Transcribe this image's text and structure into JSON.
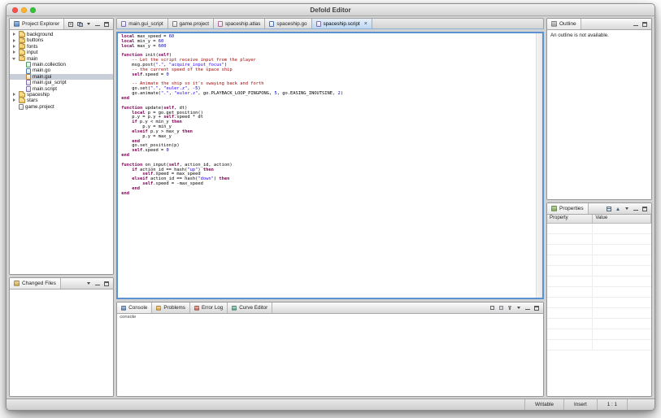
{
  "window": {
    "title": "Defold Editor"
  },
  "explorer": {
    "title": "Project Explorer",
    "items": [
      {
        "label": "background",
        "type": "folder",
        "expand": "collapsed",
        "depth": 0
      },
      {
        "label": "buttons",
        "type": "folder",
        "expand": "collapsed",
        "depth": 0
      },
      {
        "label": "fonts",
        "type": "folder",
        "expand": "collapsed",
        "depth": 0
      },
      {
        "label": "input",
        "type": "folder",
        "expand": "collapsed",
        "depth": 0
      },
      {
        "label": "main",
        "type": "folder",
        "expand": "expanded",
        "depth": 0
      },
      {
        "label": "main.collection",
        "type": "collection",
        "expand": "none",
        "depth": 1
      },
      {
        "label": "main.go",
        "type": "go",
        "expand": "none",
        "depth": 1
      },
      {
        "label": "main.gui",
        "type": "gui",
        "expand": "none",
        "depth": 1,
        "selected": true
      },
      {
        "label": "main.gui_script",
        "type": "script",
        "expand": "none",
        "depth": 1
      },
      {
        "label": "main.script",
        "type": "script",
        "expand": "none",
        "depth": 1
      },
      {
        "label": "spaceship",
        "type": "folder",
        "expand": "collapsed",
        "depth": 0
      },
      {
        "label": "stars",
        "type": "folder",
        "expand": "collapsed",
        "depth": 0
      },
      {
        "label": "game.project",
        "type": "project",
        "expand": "none",
        "depth": 0
      }
    ]
  },
  "changed_files": {
    "title": "Changed Files"
  },
  "editor": {
    "close_glyph": "×",
    "tabs": [
      {
        "label": "main.gui_script",
        "type": "script",
        "active": false
      },
      {
        "label": "game.project",
        "type": "project",
        "active": false
      },
      {
        "label": "spaceship.atlas",
        "type": "atlas",
        "active": false
      },
      {
        "label": "spaceship.go",
        "type": "go",
        "active": false
      },
      {
        "label": "spaceship.script",
        "type": "script",
        "active": true
      }
    ],
    "code_lines": [
      [
        [
          "k",
          "local"
        ],
        [
          "p",
          " max_speed = "
        ],
        [
          "n",
          "60"
        ]
      ],
      [
        [
          "k",
          "local"
        ],
        [
          "p",
          " min_y = "
        ],
        [
          "n",
          "60"
        ]
      ],
      [
        [
          "k",
          "local"
        ],
        [
          "p",
          " max_y = "
        ],
        [
          "n",
          "600"
        ]
      ],
      [],
      [
        [
          "k",
          "function"
        ],
        [
          "p",
          " init("
        ],
        [
          "k",
          "self"
        ],
        [
          "p",
          ")"
        ]
      ],
      [
        [
          "c",
          "    -- Let the script receive input from the player"
        ]
      ],
      [
        [
          "p",
          "    msg.post("
        ],
        [
          "s",
          "\".\""
        ],
        [
          "p",
          ", "
        ],
        [
          "s",
          "\"acquire_input_focus\""
        ],
        [
          "p",
          ")"
        ]
      ],
      [
        [
          "c",
          "    -- the current speed of the space ship"
        ]
      ],
      [
        [
          "p",
          "    "
        ],
        [
          "k",
          "self"
        ],
        [
          "p",
          ".speed = "
        ],
        [
          "n",
          "0"
        ]
      ],
      [],
      [
        [
          "c",
          "    -- Animate the ship so it's swaying back and forth"
        ]
      ],
      [
        [
          "p",
          "    go.set("
        ],
        [
          "s",
          "\".\""
        ],
        [
          "p",
          ", "
        ],
        [
          "s",
          "\"euler.z\""
        ],
        [
          "p",
          ", "
        ],
        [
          "n",
          "-5"
        ],
        [
          "p",
          ")"
        ]
      ],
      [
        [
          "p",
          "    go.animate("
        ],
        [
          "s",
          "\".\""
        ],
        [
          "p",
          ", "
        ],
        [
          "s",
          "\"euler.z\""
        ],
        [
          "p",
          ", go.PLAYBACK_LOOP_PINGPONG, "
        ],
        [
          "n",
          "5"
        ],
        [
          "p",
          ", go.EASING_INOUTSINE, "
        ],
        [
          "n",
          "2"
        ],
        [
          "p",
          ")"
        ]
      ],
      [
        [
          "k",
          "end"
        ]
      ],
      [],
      [
        [
          "k",
          "function"
        ],
        [
          "p",
          " update("
        ],
        [
          "k",
          "self"
        ],
        [
          "p",
          ", dt)"
        ]
      ],
      [
        [
          "p",
          "    "
        ],
        [
          "k",
          "local"
        ],
        [
          "p",
          " p = go.get_position()"
        ]
      ],
      [
        [
          "p",
          "    p.y = p.y + "
        ],
        [
          "k",
          "self"
        ],
        [
          "p",
          ".speed * dt"
        ]
      ],
      [
        [
          "p",
          "    "
        ],
        [
          "k",
          "if"
        ],
        [
          "p",
          " p.y < min_y "
        ],
        [
          "k",
          "then"
        ]
      ],
      [
        [
          "p",
          "        p.y = min_y"
        ]
      ],
      [
        [
          "p",
          "    "
        ],
        [
          "k",
          "elseif"
        ],
        [
          "p",
          " p.y > max_y "
        ],
        [
          "k",
          "then"
        ]
      ],
      [
        [
          "p",
          "        p.y = max_y"
        ]
      ],
      [
        [
          "p",
          "    "
        ],
        [
          "k",
          "end"
        ]
      ],
      [
        [
          "p",
          "    go.set_position(p)"
        ]
      ],
      [
        [
          "p",
          "    "
        ],
        [
          "k",
          "self"
        ],
        [
          "p",
          ".speed = "
        ],
        [
          "n",
          "0"
        ]
      ],
      [
        [
          "k",
          "end"
        ]
      ],
      [],
      [
        [
          "k",
          "function"
        ],
        [
          "p",
          " on_input("
        ],
        [
          "k",
          "self"
        ],
        [
          "p",
          ", action_id, action)"
        ]
      ],
      [
        [
          "p",
          "    "
        ],
        [
          "k",
          "if"
        ],
        [
          "p",
          " action_id == hash("
        ],
        [
          "s",
          "\"up\""
        ],
        [
          "p",
          ") "
        ],
        [
          "k",
          "then"
        ]
      ],
      [
        [
          "p",
          "        "
        ],
        [
          "k",
          "self"
        ],
        [
          "p",
          ".speed = max_speed"
        ]
      ],
      [
        [
          "p",
          "    "
        ],
        [
          "k",
          "elseif"
        ],
        [
          "p",
          " action_id == hash("
        ],
        [
          "s",
          "\"down\""
        ],
        [
          "p",
          ") "
        ],
        [
          "k",
          "then"
        ]
      ],
      [
        [
          "p",
          "        "
        ],
        [
          "k",
          "self"
        ],
        [
          "p",
          ".speed = -max_speed"
        ]
      ],
      [
        [
          "p",
          "    "
        ],
        [
          "k",
          "end"
        ]
      ],
      [
        [
          "k",
          "end"
        ]
      ]
    ]
  },
  "outline": {
    "title": "Outline",
    "message": "An outline is not available."
  },
  "properties": {
    "title": "Properties",
    "columns": [
      "Property",
      "Value"
    ]
  },
  "console": {
    "label": "console",
    "tabs": [
      {
        "label": "Console",
        "active": true
      },
      {
        "label": "Problems",
        "active": false
      },
      {
        "label": "Error Log",
        "active": false
      },
      {
        "label": "Curve Editor",
        "active": false
      }
    ]
  },
  "statusbar": {
    "items": [
      "Writable",
      "Insert",
      "1 : 1"
    ]
  },
  "colors": {
    "keyword": "#7f0055",
    "string": "#2a00ff",
    "comment": "#9e0000",
    "number": "#0000c0",
    "active_tab": "#bdd6f0",
    "editor_highlight": "#5b93d2"
  }
}
